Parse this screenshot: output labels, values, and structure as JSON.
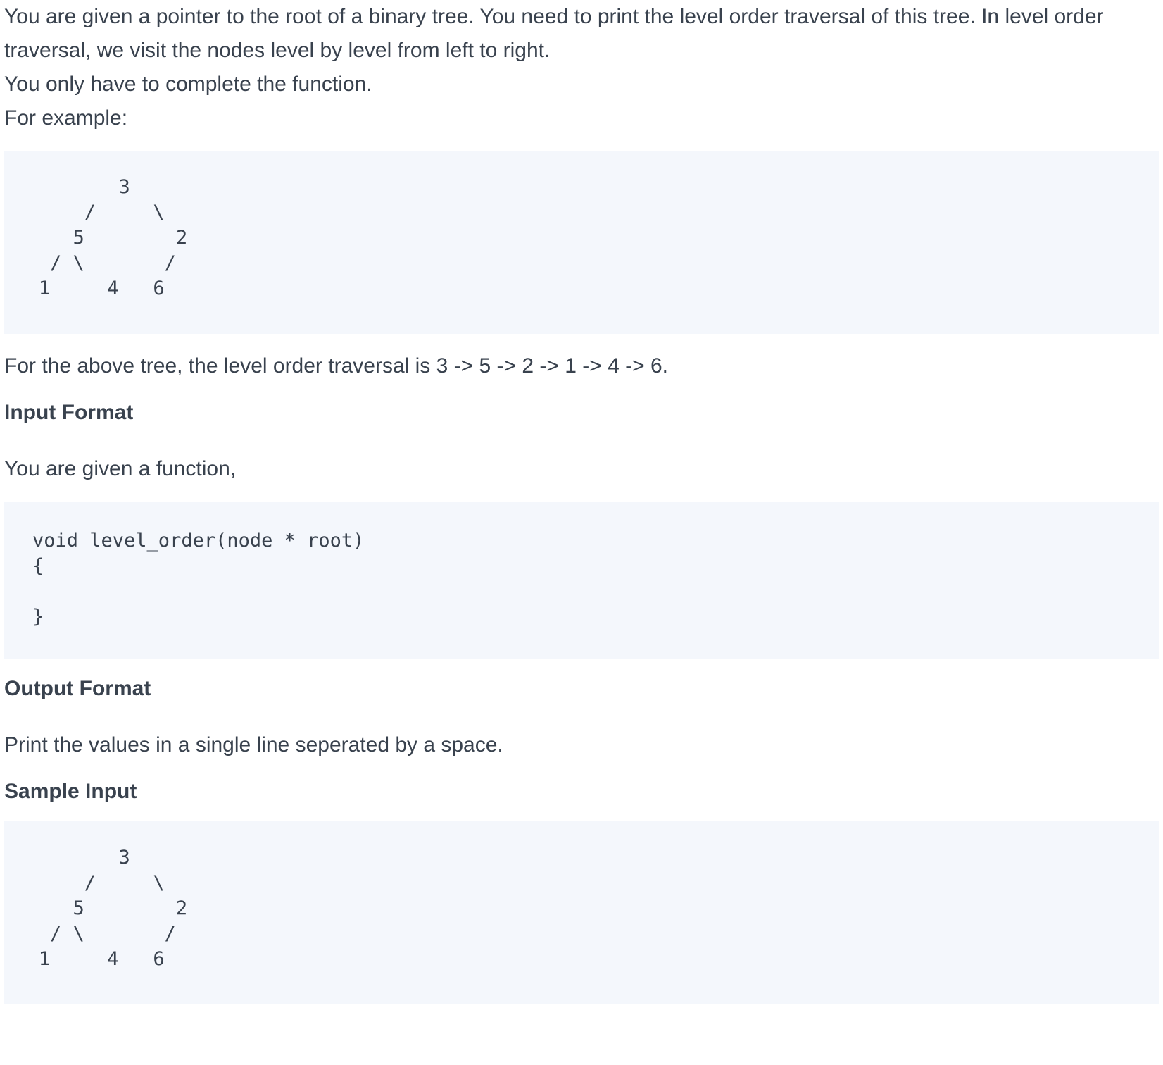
{
  "intro": {
    "line1": "You are given a pointer to the root of a binary tree. You need to print the level order traversal of this tree. In level order traversal, we visit the nodes level by level from left to right.",
    "line2": "You only have to complete the function.",
    "line3": "For example:"
  },
  "example_tree": "          3\n       /     \\\n      5        2\n    / \\       /\n   1     4   6",
  "traversal_text": "For the above tree, the level order traversal is 3 -> 5 -> 2 -> 1 -> 4 -> 6.",
  "input_format": {
    "heading": "Input Format",
    "text": "You are given a function,",
    "code": "void level_order(node * root)\n{\n\n}"
  },
  "output_format": {
    "heading": "Output Format",
    "text": "Print the values in a single line seperated by a space."
  },
  "sample_input": {
    "heading": "Sample Input",
    "tree": "          3\n       /     \\\n      5        2\n    / \\       /\n   1     4   6"
  }
}
